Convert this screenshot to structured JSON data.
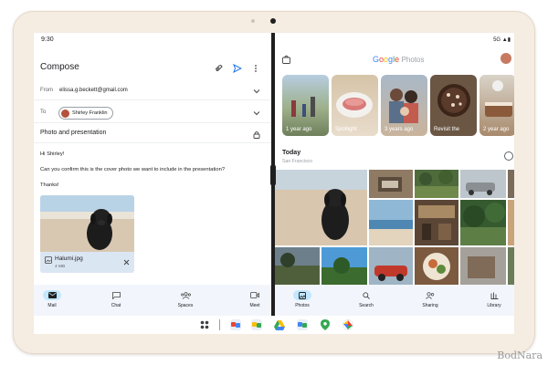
{
  "gmail": {
    "status_time": "9:30",
    "title": "Compose",
    "from_label": "From",
    "from_value": "elissa.g.beckett@gmail.com",
    "to_label": "To",
    "to_chip": "Shirley Franklin",
    "subject": "Photo and presentation",
    "body": [
      "Hi Shirley!",
      "Can you confirm this is the cover photo we want to include in the presentation?",
      "Thanks!"
    ],
    "attachment": {
      "name": "Halumi.jpg",
      "size": "4 MB"
    },
    "nav": [
      "Mail",
      "Chat",
      "Spaces",
      "Meet"
    ]
  },
  "photos": {
    "status_right": "5G ▲▮",
    "brand": {
      "g": "G",
      "o1": "o",
      "o2": "o",
      "g2": "g",
      "l": "l",
      "e": "e",
      "ph": "Photos"
    },
    "memories": [
      "1 year ago",
      "Spotlight",
      "3 years ago",
      "Revisit the",
      "2 year ago"
    ],
    "today": "Today",
    "location": "San Francisco",
    "nav": [
      "Photos",
      "Search",
      "Sharing",
      "Library"
    ]
  },
  "colors": {
    "accent": "#c2e7ff",
    "gmail_blue": "#1a73e8",
    "nav_bg": "#f2f6fc"
  },
  "watermark": "BodNara"
}
